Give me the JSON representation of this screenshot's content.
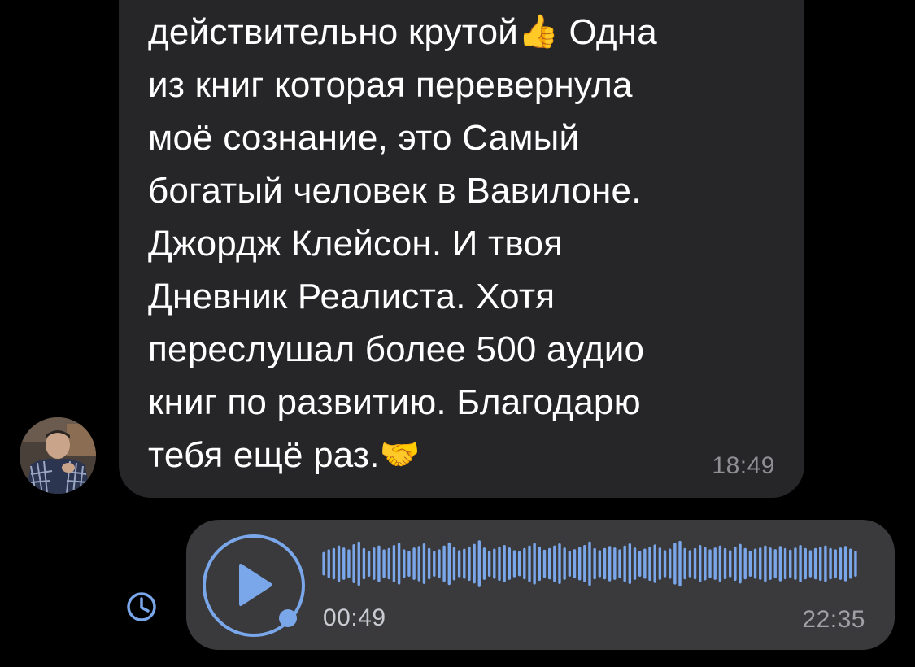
{
  "message_in": {
    "lines": [
      "действительно крутой",
      "из книг которая перевернула",
      "моё сознание, это Самый",
      "богатый человек в Вавилоне.",
      "Джордж Клейсон. И твоя",
      "Дневник Реалиста. Хотя",
      "переслушал более 500 аудио",
      "книг по развитию.  Благодарю",
      "тебя ещё раз."
    ],
    "line1_tail": " Одна",
    "emoji_thumbs": "👍",
    "emoji_handshake": "🤝",
    "time": "18:49"
  },
  "voice_message": {
    "duration": "00:49",
    "time": "22:35",
    "accent_color": "#7aa6ea",
    "waveform_levels": [
      0.45,
      0.55,
      0.6,
      0.7,
      0.62,
      0.55,
      0.75,
      0.85,
      0.6,
      0.5,
      0.62,
      0.7,
      0.55,
      0.6,
      0.72,
      0.8,
      0.55,
      0.5,
      0.62,
      0.68,
      0.78,
      0.6,
      0.5,
      0.55,
      0.7,
      0.82,
      0.64,
      0.52,
      0.58,
      0.66,
      0.76,
      0.9,
      0.62,
      0.5,
      0.58,
      0.66,
      0.72,
      0.62,
      0.52,
      0.48,
      0.6,
      0.7,
      0.8,
      0.66,
      0.54,
      0.6,
      0.7,
      0.78,
      0.62,
      0.5,
      0.56,
      0.64,
      0.72,
      0.85,
      0.6,
      0.52,
      0.6,
      0.68,
      0.62,
      0.55,
      0.7,
      0.78,
      0.62,
      0.5,
      0.58,
      0.66,
      0.74,
      0.62,
      0.52,
      0.58,
      0.8,
      0.88,
      0.6,
      0.52,
      0.6,
      0.72,
      0.64,
      0.55,
      0.62,
      0.7,
      0.6,
      0.52,
      0.66,
      0.76,
      0.6,
      0.5,
      0.58,
      0.62,
      0.7,
      0.62,
      0.56,
      0.68,
      0.6,
      0.54,
      0.62,
      0.72,
      0.6,
      0.52,
      0.6,
      0.66,
      0.7,
      0.6,
      0.55,
      0.62,
      0.68,
      0.58,
      0.5
    ],
    "played_fraction": 0.0
  },
  "icons": {
    "play": "play-icon",
    "pending": "clock-icon",
    "avatar": "user-avatar"
  }
}
